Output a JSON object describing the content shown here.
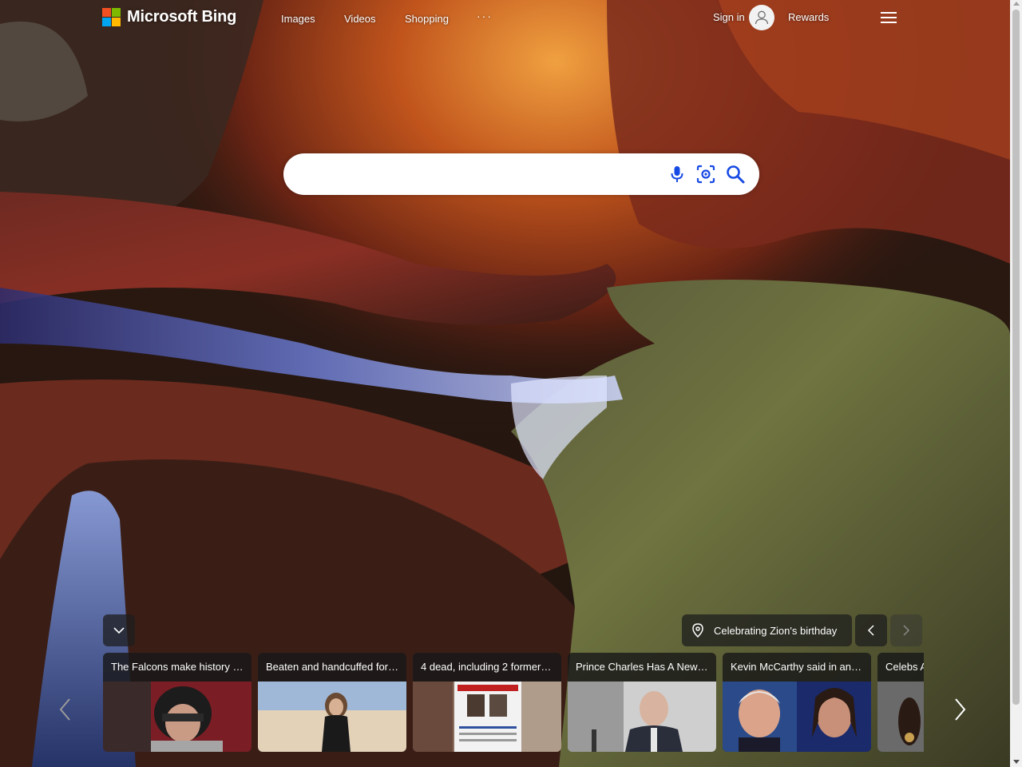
{
  "header": {
    "logo_text": "Microsoft Bing",
    "nav": {
      "images": "Images",
      "videos": "Videos",
      "shopping": "Shopping",
      "more": "···"
    },
    "signin": "Sign in",
    "rewards": "Rewards"
  },
  "search": {
    "value": "",
    "placeholder": ""
  },
  "image_info": {
    "label": "Celebrating Zion's birthday"
  },
  "news": [
    {
      "title": "The Falcons make history …"
    },
    {
      "title": "Beaten and handcuffed for…"
    },
    {
      "title": "4 dead, including 2 former…"
    },
    {
      "title": "Prince Charles Has A New…"
    },
    {
      "title": "Kevin McCarthy said in an…"
    },
    {
      "title": "Celebs A"
    }
  ],
  "colors": {
    "ms_red": "#f25022",
    "ms_green": "#7fba00",
    "ms_blue": "#00a4ef",
    "ms_yellow": "#ffb900",
    "search_icon_blue": "#174ae4",
    "card_bg": "#191919"
  },
  "icons": {
    "mic": "microphone-icon",
    "visual_search": "visual-search-icon",
    "search": "search-icon",
    "menu": "hamburger-menu-icon",
    "location": "location-pin-icon"
  }
}
